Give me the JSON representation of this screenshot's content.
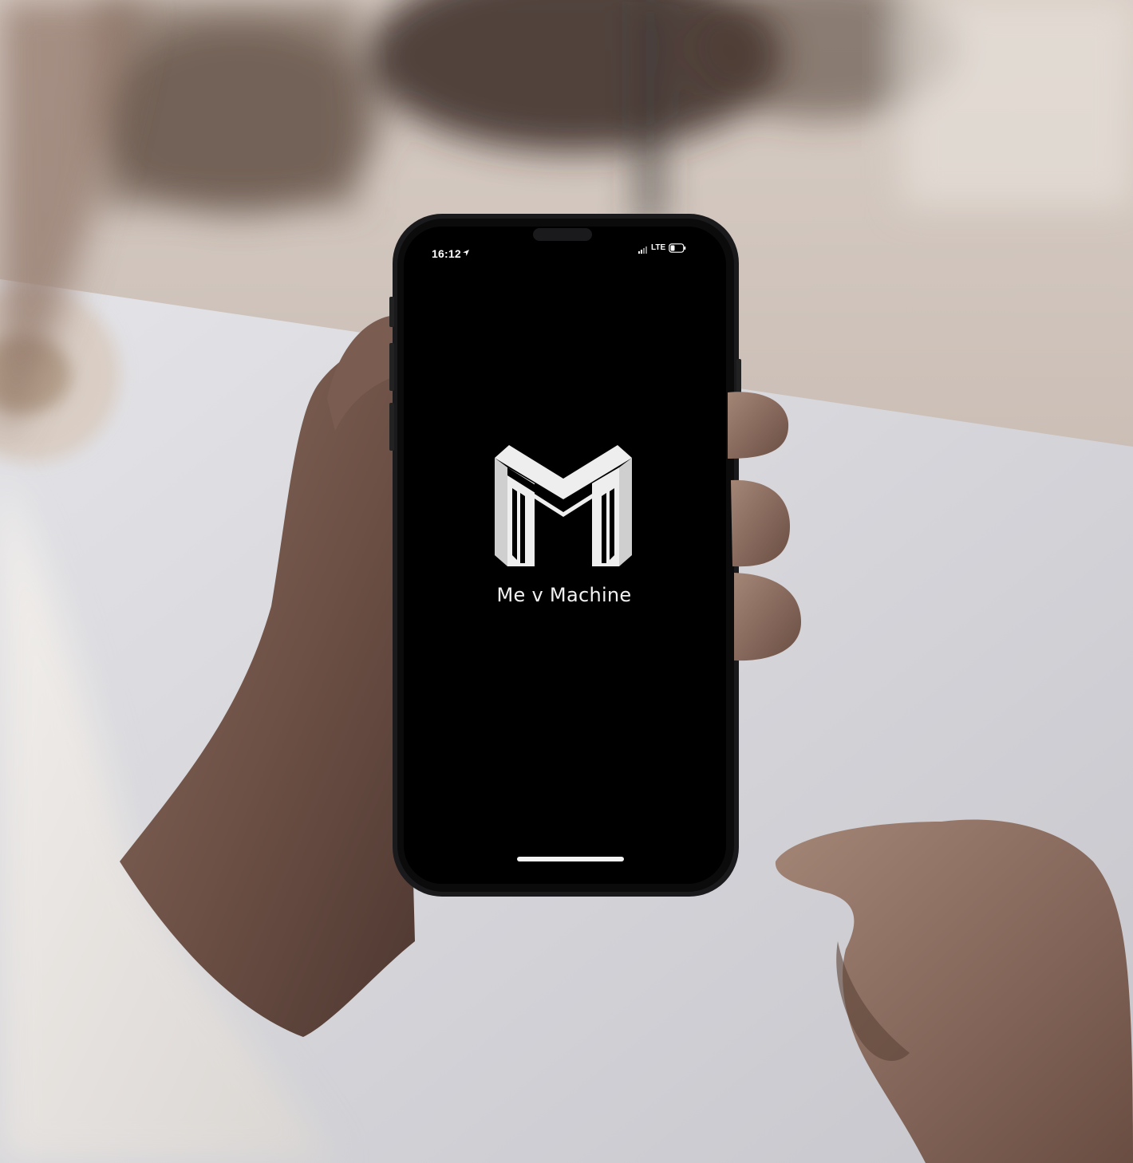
{
  "status_bar": {
    "time": "16:12",
    "network": "LTE",
    "icons": [
      "location-arrow-icon",
      "signal-icon",
      "battery-icon"
    ]
  },
  "splash": {
    "logo_icon": "m-logo-icon",
    "app_name": "Me v Machine"
  },
  "home_indicator": "home-indicator",
  "colors": {
    "screen_background": "#000000",
    "logo": "#eeeeee",
    "text": "#f2f2f2"
  }
}
